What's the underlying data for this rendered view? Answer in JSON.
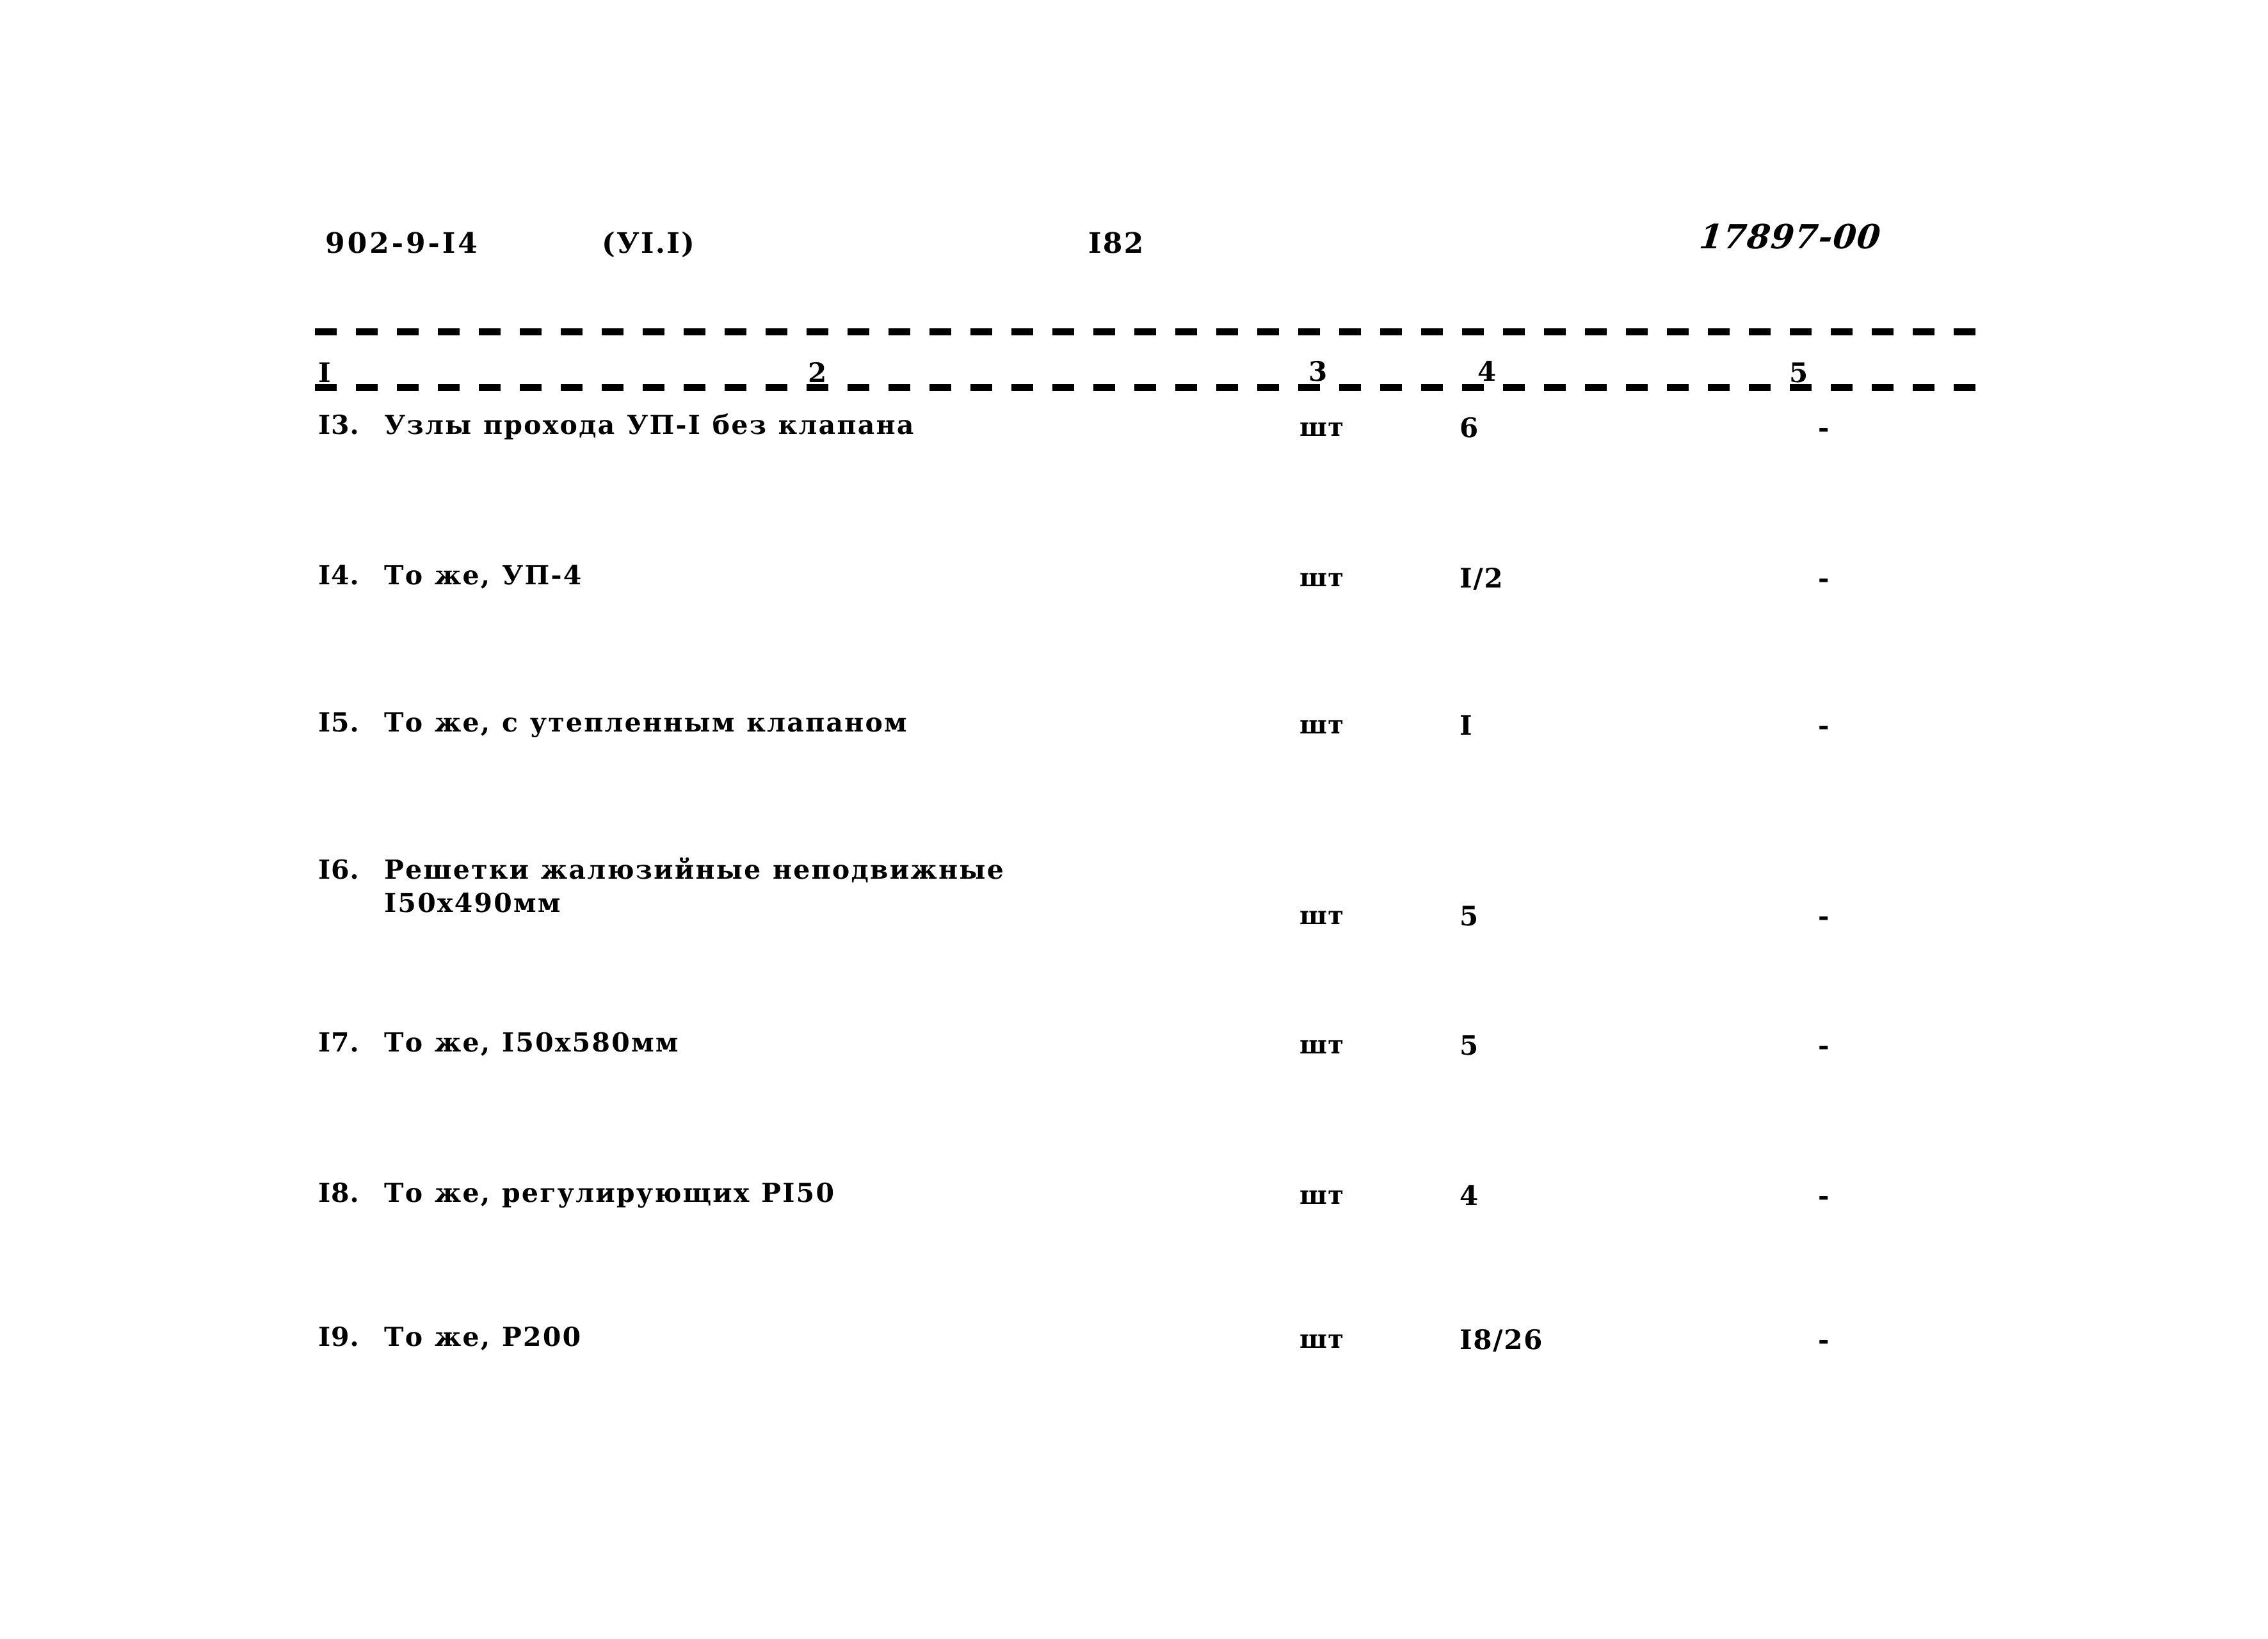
{
  "header": {
    "doc_code": "902-9-I4",
    "series_code": "(УI.I)",
    "page_number": "I82",
    "archive_code": "17897-00"
  },
  "table": {
    "column_numbers": [
      "I",
      "2",
      "3",
      "4",
      "5"
    ],
    "rows": [
      {
        "index": "I3.",
        "name_line1": "Узлы прохода УП-I без клапана",
        "name_line2": "",
        "unit": "шт",
        "qty": "6",
        "note": "-"
      },
      {
        "index": "I4.",
        "name_line1": "То же, УП-4",
        "name_line2": "",
        "unit": "шт",
        "qty": "I/2",
        "note": "-"
      },
      {
        "index": "I5.",
        "name_line1": "То же, с утепленным клапаном",
        "name_line2": "",
        "unit": "шт",
        "qty": "I",
        "note": "-"
      },
      {
        "index": "I6.",
        "name_line1": "Решетки жалюзийные неподвижные",
        "name_line2": "I50x490мм",
        "unit": "шт",
        "qty": "5",
        "note": "-"
      },
      {
        "index": "I7.",
        "name_line1": "То же, I50x580мм",
        "name_line2": "",
        "unit": "шт",
        "qty": "5",
        "note": "-"
      },
      {
        "index": "I8.",
        "name_line1": "То же, регулирующих РI50",
        "name_line2": "",
        "unit": "шт",
        "qty": "4",
        "note": "-"
      },
      {
        "index": "I9.",
        "name_line1": "То же, Р200",
        "name_line2": "",
        "unit": "шт",
        "qty": "I8/26",
        "note": "-"
      }
    ]
  }
}
